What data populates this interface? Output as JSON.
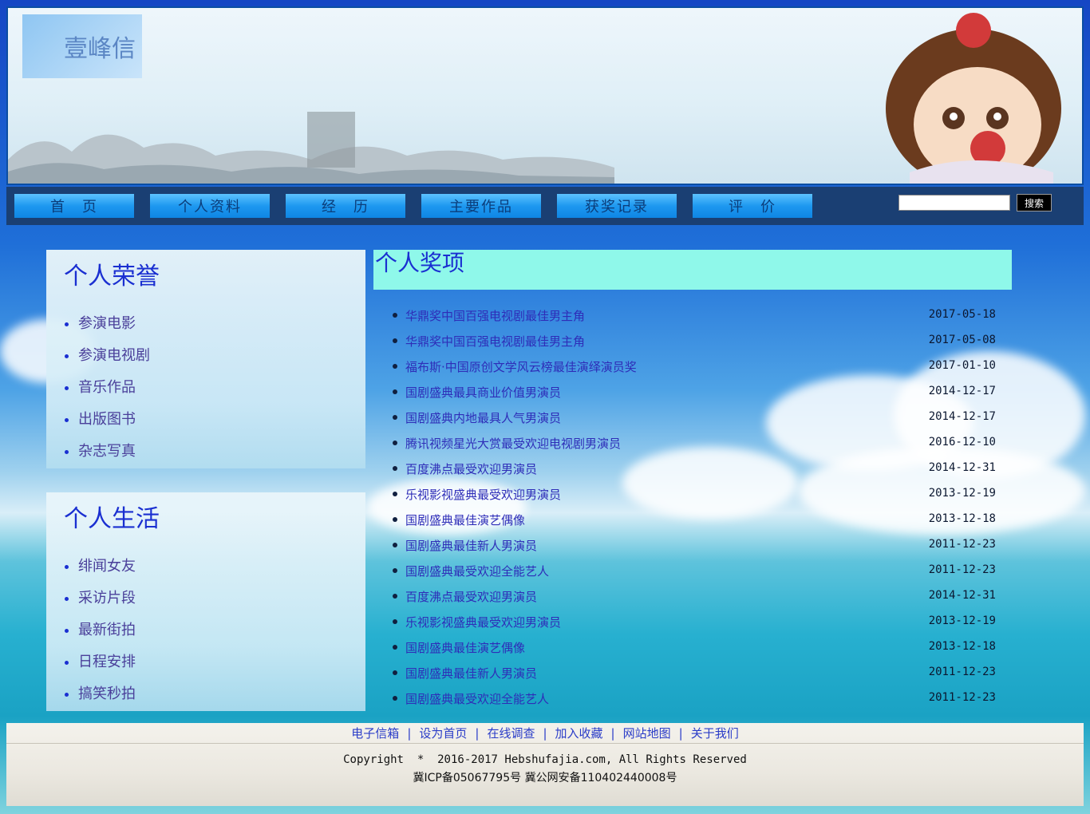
{
  "logo": {
    "text": "壹峰信"
  },
  "nav": {
    "items": [
      "首　页",
      "个人资料",
      "经　历",
      "主要作品",
      "获奖记录",
      "评　价"
    ],
    "search_button": "搜索",
    "search_value": ""
  },
  "honors": {
    "title": "个人荣誉",
    "items": [
      "参演电影",
      "参演电视剧",
      "音乐作品",
      "出版图书",
      "杂志写真"
    ]
  },
  "life": {
    "title": "个人生活",
    "items": [
      "绯闻女友",
      "采访片段",
      "最新街拍",
      "日程安排",
      "搞笑秒拍"
    ]
  },
  "awards": {
    "title": "个人奖项",
    "items": [
      {
        "title": "华鼎奖中国百强电视剧最佳男主角",
        "date": "2017-05-18"
      },
      {
        "title": "华鼎奖中国百强电视剧最佳男主角",
        "date": "2017-05-08"
      },
      {
        "title": "福布斯·中国原创文学风云榜最佳演绎演员奖",
        "date": "2017-01-10"
      },
      {
        "title": "国剧盛典最具商业价值男演员",
        "date": "2014-12-17"
      },
      {
        "title": "国剧盛典内地最具人气男演员",
        "date": "2014-12-17"
      },
      {
        "title": "腾讯视频星光大赏最受欢迎电视剧男演员",
        "date": "2016-12-10"
      },
      {
        "title": "百度沸点最受欢迎男演员",
        "date": "2014-12-31"
      },
      {
        "title": "乐视影视盛典最受欢迎男演员",
        "date": "2013-12-19"
      },
      {
        "title": "国剧盛典最佳演艺偶像",
        "date": "2013-12-18"
      },
      {
        "title": "国剧盛典最佳新人男演员",
        "date": "2011-12-23"
      },
      {
        "title": "国剧盛典最受欢迎全能艺人",
        "date": "2011-12-23"
      },
      {
        "title": "百度沸点最受欢迎男演员",
        "date": "2014-12-31"
      },
      {
        "title": "乐视影视盛典最受欢迎男演员",
        "date": "2013-12-19"
      },
      {
        "title": "国剧盛典最佳演艺偶像",
        "date": "2013-12-18"
      },
      {
        "title": "国剧盛典最佳新人男演员",
        "date": "2011-12-23"
      },
      {
        "title": "国剧盛典最受欢迎全能艺人",
        "date": "2011-12-23"
      }
    ]
  },
  "footer": {
    "links": [
      "电子信箱",
      "设为首页",
      "在线调查",
      "加入收藏",
      "网站地图",
      "关于我们"
    ],
    "copyright": "Copyright  *  2016-2017 Hebshufajia.com, All Rights Reserved",
    "icp": "冀ICP备05067795号 冀公网安备110402440008号"
  },
  "colors": {
    "nav_bg": "#1a3f73",
    "nav_button": "#1e98f0",
    "link_blue": "#1a2fd1",
    "awards_title_bg": "#8ff8ea"
  }
}
